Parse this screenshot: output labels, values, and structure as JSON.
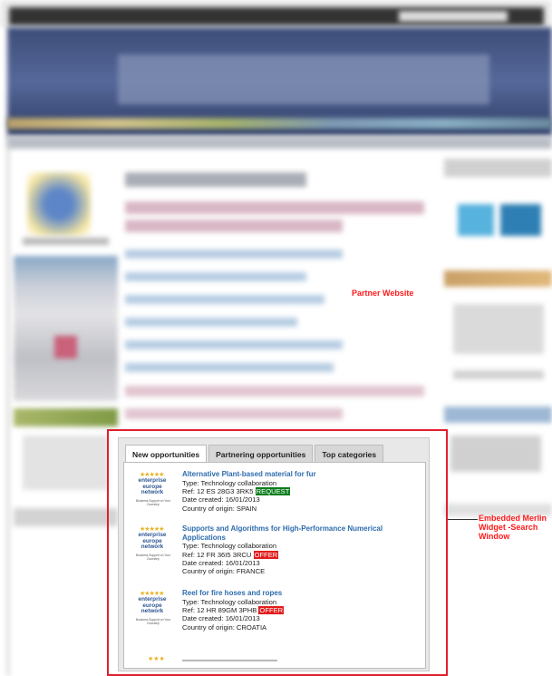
{
  "annotations": {
    "partner_website": "Partner Website",
    "embedded_widget_line1": "Embedded Merlin",
    "embedded_widget_line2": "Widget -Search",
    "embedded_widget_line3": "Window"
  },
  "widget": {
    "tabs": [
      {
        "label": "New opportunities",
        "active": true
      },
      {
        "label": "Partnering opportunities",
        "active": false
      },
      {
        "label": "Top categories",
        "active": false
      }
    ],
    "logo": {
      "line1": "enterprise",
      "line2": "europe",
      "line3": "network",
      "tagline": "Business Support on Your Doorstep"
    },
    "items": [
      {
        "title": "Alternative Plant-based material for fur",
        "type": "Type: Technology collaboration",
        "ref": "Ref: 12 ES 28G3 3RK5",
        "badge": "REQUEST",
        "date": "Date created: 16/01/2013",
        "country": "Country of origin: SPAIN"
      },
      {
        "title": "Supports and Algorithms for High-Performance Numerical Applications",
        "type": "Type: Technology collaboration",
        "ref": "Ref: 12 FR 36I5 3RCU",
        "badge": "OFFER",
        "date": "Date created: 16/01/2013",
        "country": "Country of origin: FRANCE"
      },
      {
        "title": "Reel for fire hoses and ropes",
        "type": "Type: Technology collaboration",
        "ref": "Ref: 12 HR 89GM 3PHB",
        "badge": "OFFER",
        "date": "Date created: 16/01/2013",
        "country": "Country of origin: CROATIA"
      }
    ]
  },
  "colors": {
    "highlight": "#e01f2f",
    "annotation": "#ff1a1a",
    "request": "#0a7d1c",
    "offer": "#e11b1b",
    "link": "#2d6cad"
  }
}
